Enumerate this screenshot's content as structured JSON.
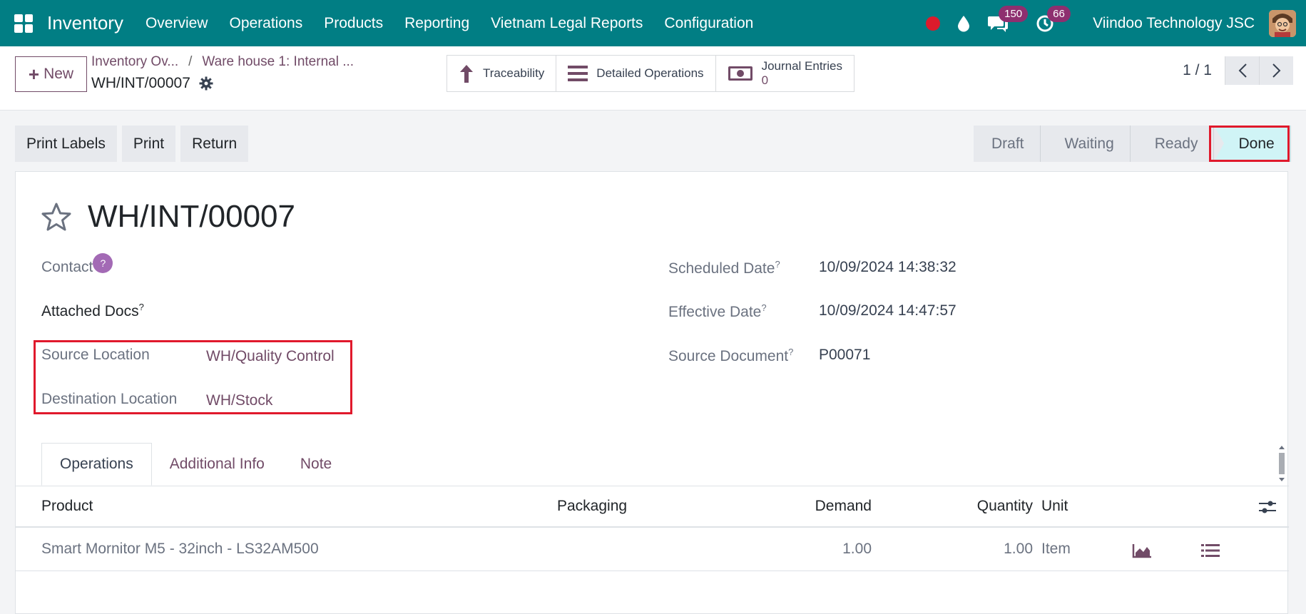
{
  "navbar": {
    "app_name": "Inventory",
    "menu": [
      "Overview",
      "Operations",
      "Products",
      "Reporting",
      "Vietnam Legal Reports",
      "Configuration"
    ],
    "messages_count": "150",
    "activities_count": "66",
    "company": "Viindoo Technology JSC"
  },
  "control": {
    "new_label": "New",
    "breadcrumb": [
      "Inventory Ov...",
      "Ware house 1: Internal ..."
    ],
    "record_name": "WH/INT/00007",
    "smart_buttons": {
      "traceability": "Traceability",
      "detailed_operations": "Detailed Operations",
      "journal_entries": "Journal Entries",
      "journal_entries_count": "0"
    },
    "pager": "1 / 1"
  },
  "actions": {
    "print_labels": "Print Labels",
    "print": "Print",
    "return": "Return"
  },
  "statusbar": {
    "stages": [
      "Draft",
      "Waiting",
      "Ready",
      "Done"
    ],
    "active": "Done"
  },
  "form": {
    "title": "WH/INT/00007",
    "contact_label": "Contact",
    "contact_help": "?",
    "attached_docs_label": "Attached Docs",
    "source_location_label": "Source Location",
    "source_location_value": "WH/Quality Control",
    "destination_location_label": "Destination Location",
    "destination_location_value": "WH/Stock",
    "scheduled_date_label": "Scheduled Date",
    "scheduled_date_value": "10/09/2024 14:38:32",
    "effective_date_label": "Effective Date",
    "effective_date_value": "10/09/2024 14:47:57",
    "source_document_label": "Source Document",
    "source_document_value": "P00071",
    "help_mark": "?"
  },
  "tabs": [
    "Operations",
    "Additional Info",
    "Note"
  ],
  "table": {
    "headers": {
      "product": "Product",
      "packaging": "Packaging",
      "demand": "Demand",
      "quantity": "Quantity",
      "unit": "Unit"
    },
    "rows": [
      {
        "product": "Smart Mornitor M5 - 32inch - LS32AM500",
        "packaging": "",
        "demand": "1.00",
        "quantity": "1.00",
        "unit": "Item"
      }
    ]
  },
  "colors": {
    "navbar": "#017e84",
    "primary": "#714b67",
    "highlight": "#e0192c",
    "done_stage": "#d0f4f6"
  }
}
